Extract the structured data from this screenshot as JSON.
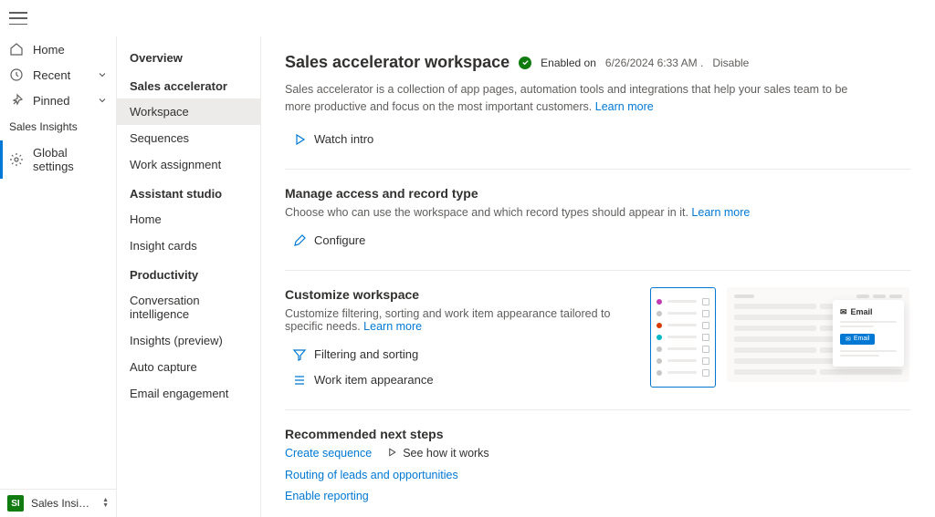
{
  "nav": {
    "items": [
      {
        "label": "Home",
        "icon": "home"
      },
      {
        "label": "Recent",
        "icon": "clock",
        "chevron": true
      },
      {
        "label": "Pinned",
        "icon": "pin",
        "chevron": true
      }
    ],
    "section_title": "Sales Insights",
    "selected": {
      "label": "Global settings",
      "icon": "gear"
    },
    "footer_badge": "SI",
    "footer_text": "Sales Insights sett…"
  },
  "sidebar": {
    "groups": [
      {
        "title": "Overview",
        "items": []
      },
      {
        "title": "Sales accelerator",
        "items": [
          "Workspace",
          "Sequences",
          "Work assignment"
        ],
        "active_index": 0
      },
      {
        "title": "Assistant studio",
        "items": [
          "Home",
          "Insight cards"
        ]
      },
      {
        "title": "Productivity",
        "items": [
          "Conversation intelligence",
          "Insights (preview)",
          "Auto capture",
          "Email engagement"
        ]
      }
    ]
  },
  "header": {
    "title": "Sales accelerator workspace",
    "status": "Enabled on",
    "date": "6/26/2024 6:33 AM .",
    "disable": "Disable",
    "description": "Sales accelerator is a collection of app pages, automation tools and integrations that help your sales team to be more productive and focus on the most important customers.",
    "learn_more": "Learn more",
    "watch_intro": "Watch intro"
  },
  "access": {
    "title": "Manage access and record type",
    "desc": "Choose who can use the workspace and which record types should appear in it.",
    "learn_more": "Learn more",
    "configure": "Configure"
  },
  "customize": {
    "title": "Customize workspace",
    "desc": "Customize filtering, sorting and work item appearance tailored to specific needs.",
    "learn_more": "Learn more",
    "filter": "Filtering and sorting",
    "appearance": "Work item appearance",
    "email_label": "Email",
    "email_btn": "Email"
  },
  "next": {
    "title": "Recommended next steps",
    "create_sequence": "Create sequence",
    "see_how": "See how it works",
    "routing": "Routing of leads and opportunities",
    "enable_reporting": "Enable reporting"
  }
}
